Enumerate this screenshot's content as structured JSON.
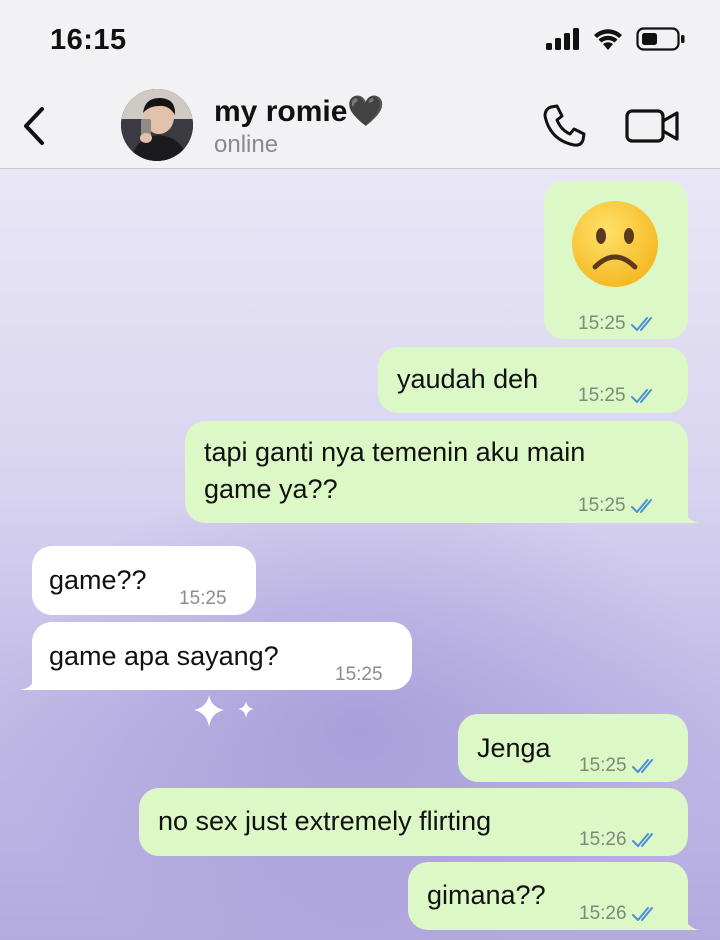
{
  "status_bar": {
    "time": "16:15"
  },
  "header": {
    "contact_name": "my romie🖤",
    "contact_status": "online"
  },
  "messages": [
    {
      "type": "emoji",
      "direction": "outgoing",
      "emoji": "frowning-face",
      "time": "15:25",
      "status": "read"
    },
    {
      "type": "text",
      "direction": "outgoing",
      "text": "yaudah deh",
      "time": "15:25",
      "status": "read"
    },
    {
      "type": "text",
      "direction": "outgoing",
      "lines": [
        "tapi ganti nya temenin aku main",
        "game ya??"
      ],
      "time": "15:25",
      "status": "read"
    },
    {
      "type": "text",
      "direction": "incoming",
      "text": "game??",
      "time": "15:25"
    },
    {
      "type": "text",
      "direction": "incoming",
      "text": "game apa sayang?",
      "time": "15:25"
    },
    {
      "type": "text",
      "direction": "outgoing",
      "text": "Jenga",
      "time": "15:25",
      "status": "read"
    },
    {
      "type": "text",
      "direction": "outgoing",
      "text": "no sex just extremely flirting",
      "time": "15:26",
      "status": "read"
    },
    {
      "type": "text",
      "direction": "outgoing",
      "text": "gimana??",
      "time": "15:26",
      "status": "read"
    }
  ],
  "colors": {
    "outgoing_bubble": "#dcf8c6",
    "incoming_bubble": "#ffffff",
    "read_tick": "#4a8fd8",
    "chat_wallpaper": "#c1bae6"
  }
}
